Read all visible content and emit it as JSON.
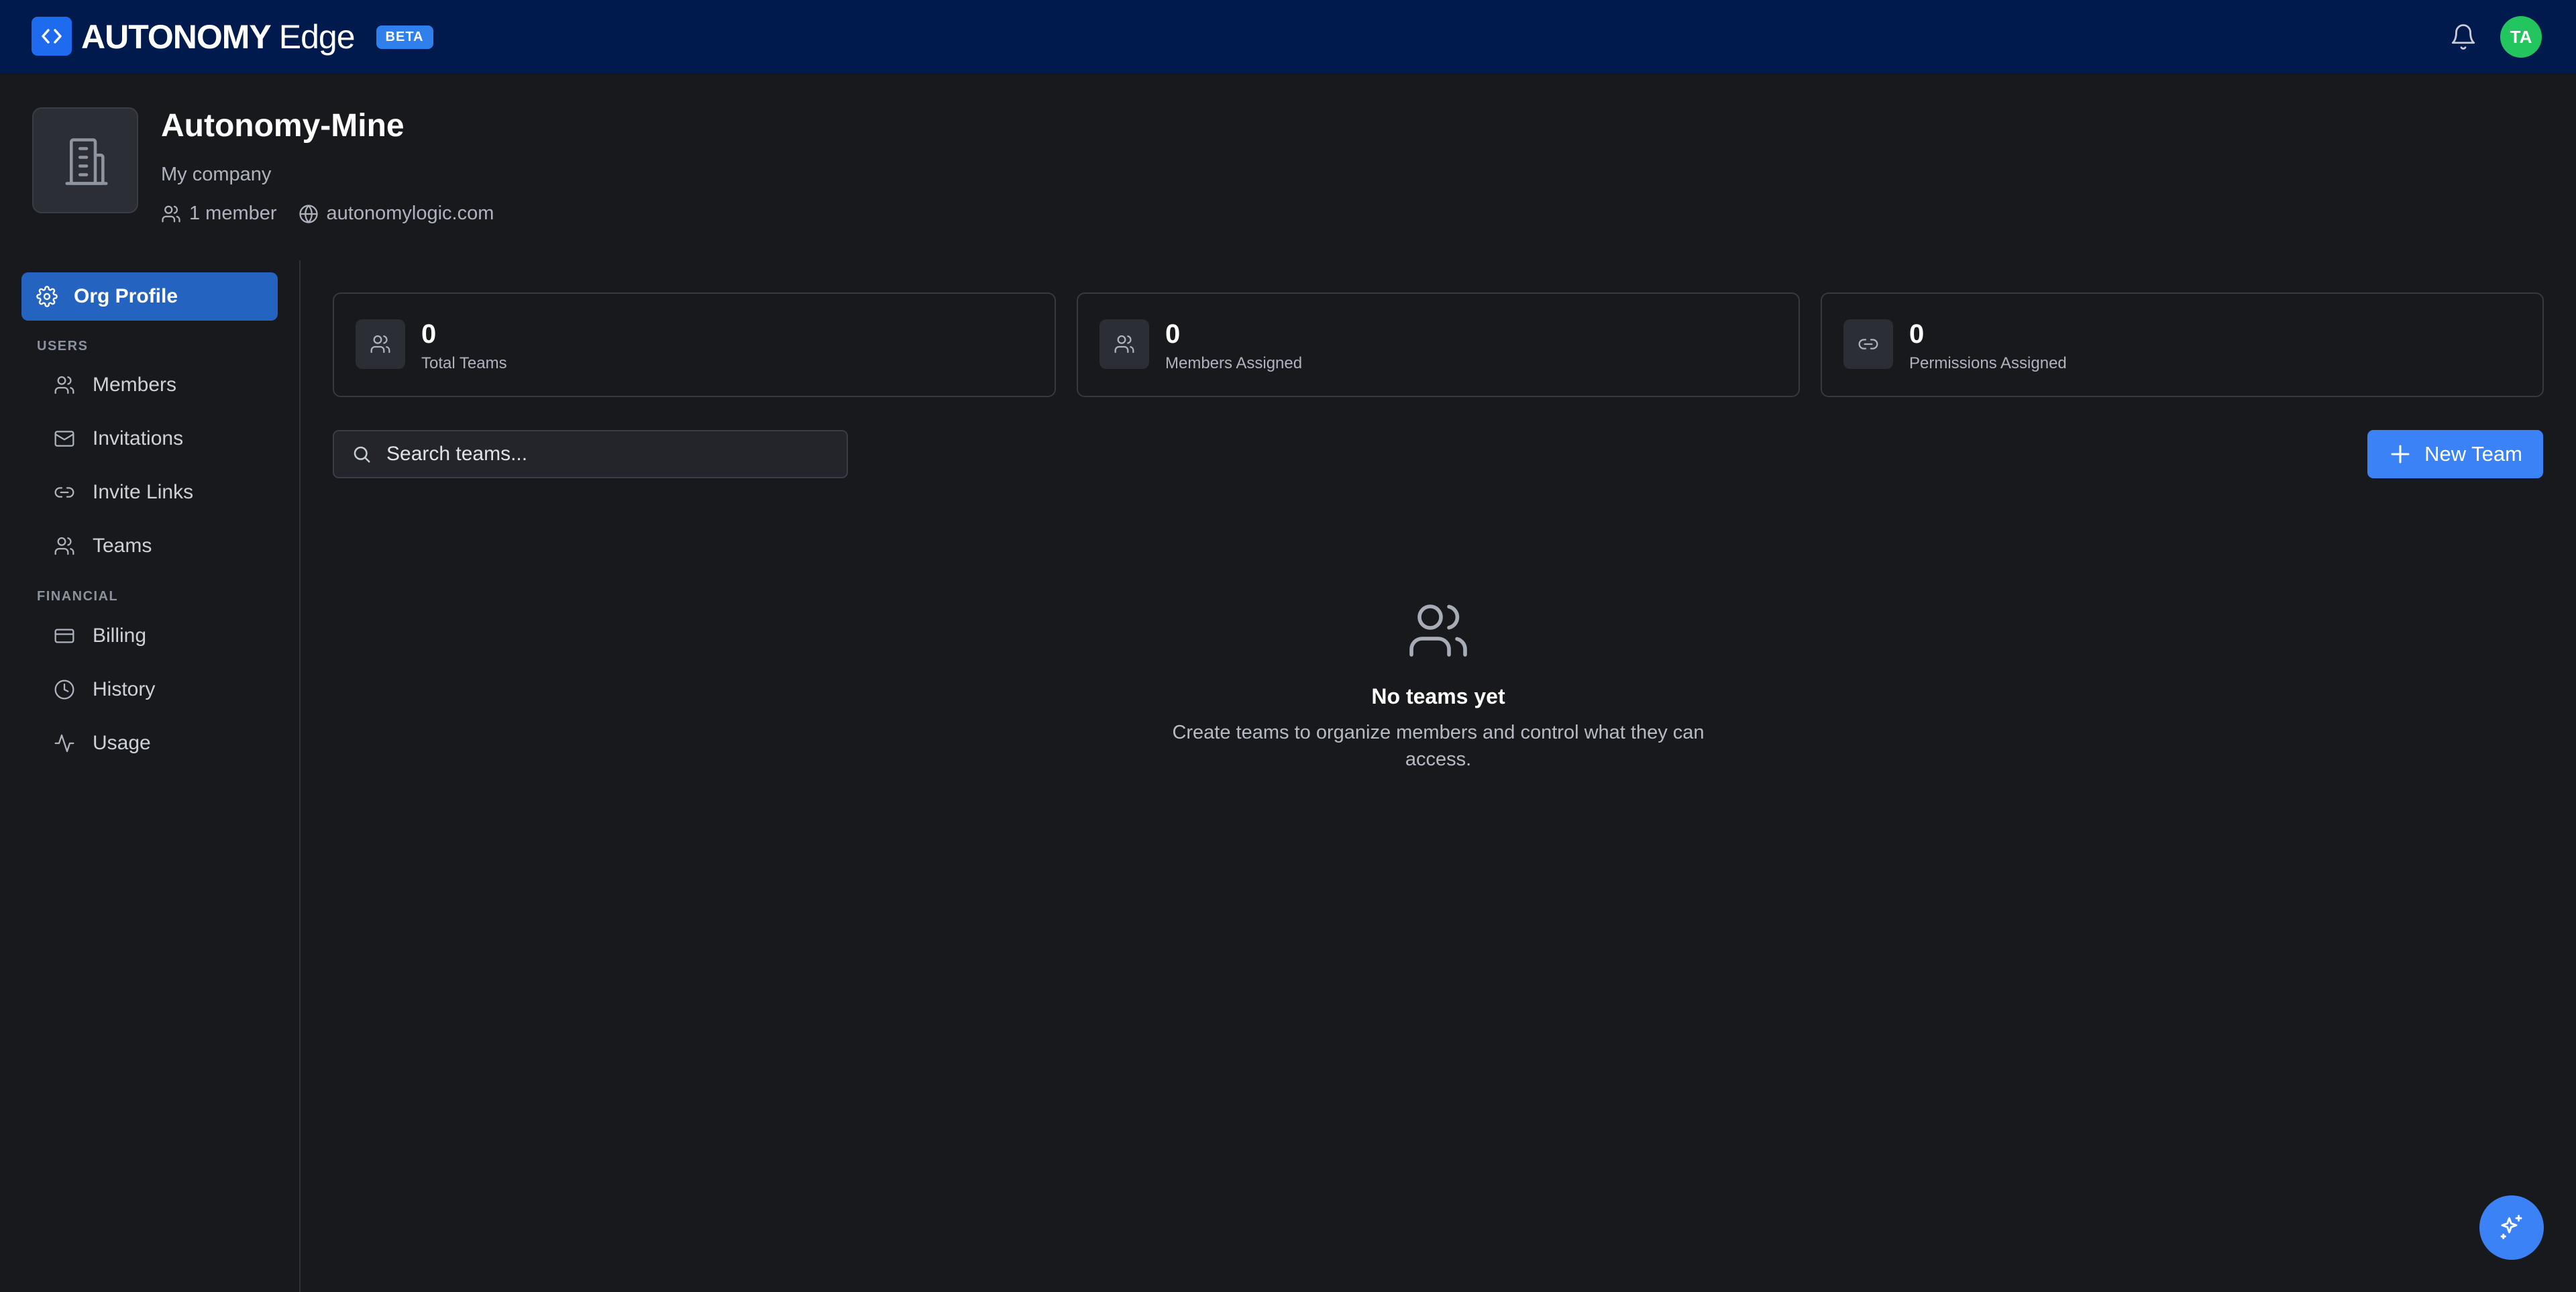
{
  "app": {
    "brand_main": "AUTONOMY",
    "brand_sub": "Edge",
    "badge": "BETA",
    "avatar_initials": "TA",
    "brand_color": "#1f6bf0",
    "avatar_color": "#22c55e"
  },
  "org": {
    "name": "Autonomy-Mine",
    "description": "My company",
    "members": "1 member",
    "domain": "autonomylogic.com"
  },
  "sidebar": {
    "active": "Org Profile",
    "sections": [
      {
        "title": "USERS",
        "items": [
          "Members",
          "Invitations",
          "Invite Links",
          "Teams"
        ]
      },
      {
        "title": "FINANCIAL",
        "items": [
          "Billing",
          "History",
          "Usage"
        ]
      }
    ],
    "active_color": "#2563c0"
  },
  "stats": [
    {
      "value": "0",
      "label": "Total Teams",
      "icon": "users-icon"
    },
    {
      "value": "0",
      "label": "Members Assigned",
      "icon": "users-icon"
    },
    {
      "value": "0",
      "label": "Permissions Assigned",
      "icon": "link-icon"
    }
  ],
  "search": {
    "placeholder": "Search teams..."
  },
  "actions": {
    "new_team": "New Team",
    "accent_color": "#3b82f6"
  },
  "empty_state": {
    "title": "No teams yet",
    "description": "Create teams to organize members and control what they can access."
  }
}
